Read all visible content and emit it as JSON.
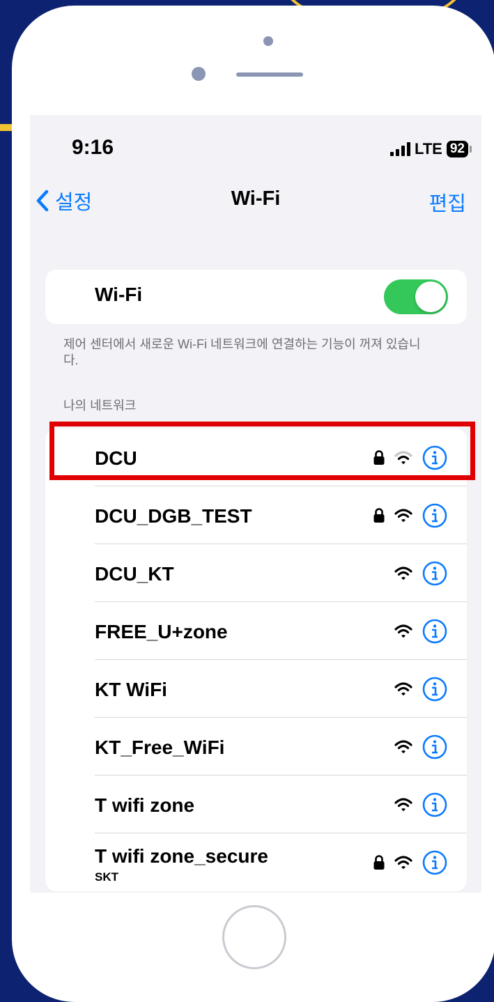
{
  "status_bar": {
    "time": "9:16",
    "network": "LTE",
    "battery": "92"
  },
  "nav": {
    "back_label": "설정",
    "title": "Wi-Fi",
    "edit_label": "편집"
  },
  "wifi_toggle": {
    "label": "Wi-Fi",
    "on": true,
    "footnote": "제어 센터에서 새로운 Wi-Fi 네트워크에 연결하는 기능이 꺼져 있습니다."
  },
  "my_networks": {
    "header": "나의 네트워크",
    "items": [
      {
        "name": "DCU",
        "locked": true,
        "signal": "weak"
      },
      {
        "name": "DCU_DGB_TEST",
        "locked": true,
        "signal": "full"
      },
      {
        "name": "DCU_KT",
        "locked": false,
        "signal": "full"
      },
      {
        "name": "FREE_U+zone",
        "locked": false,
        "signal": "full"
      },
      {
        "name": "KT WiFi",
        "locked": false,
        "signal": "full"
      },
      {
        "name": "KT_Free_WiFi",
        "locked": false,
        "signal": "full"
      },
      {
        "name": "T wifi zone",
        "locked": false,
        "signal": "full"
      },
      {
        "name": "T wifi zone_secure",
        "subtitle": "SKT",
        "locked": true,
        "signal": "full"
      }
    ]
  },
  "colors": {
    "accent": "#0a7aff",
    "toggle_on": "#34c759",
    "highlight": "#e00000",
    "background": "#0d2270"
  },
  "icons": {
    "back": "chevron-left-icon",
    "lock": "lock-icon",
    "wifi": "wifi-signal-icon",
    "info": "info-icon"
  }
}
